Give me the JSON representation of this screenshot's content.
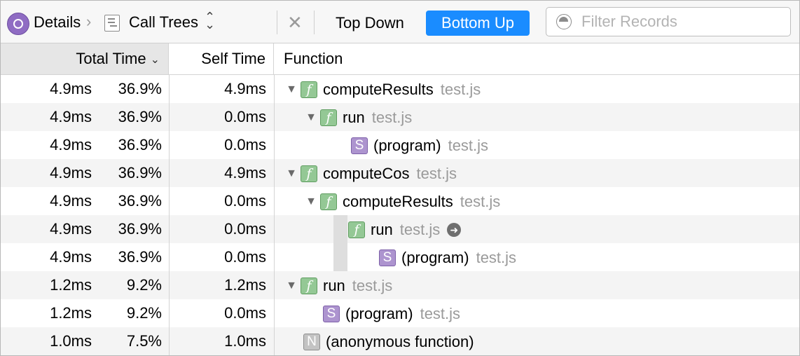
{
  "toolbar": {
    "details_label": "Details",
    "calltrees_label": "Call Trees",
    "topdown_label": "Top Down",
    "bottomup_label": "Bottom Up",
    "filter_placeholder": "Filter Records",
    "accent_color": "#1a8cff"
  },
  "header": {
    "total_time": "Total Time",
    "self_time": "Self Time",
    "function": "Function"
  },
  "rows": [
    {
      "total_ms": "4.9ms",
      "total_pct": "36.9%",
      "self": "4.9ms",
      "badge": "f",
      "name": "computeResults",
      "file": "test.js"
    },
    {
      "total_ms": "4.9ms",
      "total_pct": "36.9%",
      "self": "0.0ms",
      "badge": "f",
      "name": "run",
      "file": "test.js"
    },
    {
      "total_ms": "4.9ms",
      "total_pct": "36.9%",
      "self": "0.0ms",
      "badge": "S",
      "name": "(program)",
      "file": "test.js"
    },
    {
      "total_ms": "4.9ms",
      "total_pct": "36.9%",
      "self": "4.9ms",
      "badge": "f",
      "name": "computeCos",
      "file": "test.js"
    },
    {
      "total_ms": "4.9ms",
      "total_pct": "36.9%",
      "self": "0.0ms",
      "badge": "f",
      "name": "computeResults",
      "file": "test.js"
    },
    {
      "total_ms": "4.9ms",
      "total_pct": "36.9%",
      "self": "0.0ms",
      "badge": "f",
      "name": "run",
      "file": "test.js"
    },
    {
      "total_ms": "4.9ms",
      "total_pct": "36.9%",
      "self": "0.0ms",
      "badge": "S",
      "name": "(program)",
      "file": "test.js"
    },
    {
      "total_ms": "1.2ms",
      "total_pct": "9.2%",
      "self": "1.2ms",
      "badge": "f",
      "name": "run",
      "file": "test.js"
    },
    {
      "total_ms": "1.2ms",
      "total_pct": "9.2%",
      "self": "0.0ms",
      "badge": "S",
      "name": "(program)",
      "file": "test.js"
    },
    {
      "total_ms": "1.0ms",
      "total_pct": "7.5%",
      "self": "1.0ms",
      "badge": "N",
      "name": "(anonymous function)",
      "file": ""
    }
  ]
}
